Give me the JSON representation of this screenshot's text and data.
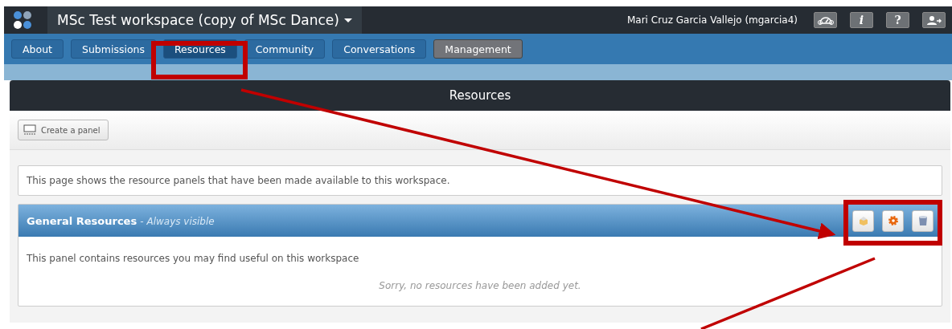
{
  "workspace": {
    "title": "MSc Test workspace (copy of MSc Dance)",
    "user": "Mari Cruz Garcia Vallejo (mgarcia4)",
    "tools": [
      {
        "kind": "gauge"
      },
      {
        "kind": "info",
        "label": "i"
      },
      {
        "kind": "help",
        "label": "?"
      },
      {
        "kind": "exit"
      }
    ]
  },
  "tabs": [
    {
      "label": "About",
      "selected": false,
      "kind": "normal"
    },
    {
      "label": "Submissions",
      "selected": false,
      "kind": "normal"
    },
    {
      "label": "Resources",
      "selected": true,
      "kind": "normal"
    },
    {
      "label": "Community",
      "selected": false,
      "kind": "normal"
    },
    {
      "label": "Conversations",
      "selected": false,
      "kind": "normal"
    },
    {
      "label": "Management",
      "selected": false,
      "kind": "admin"
    }
  ],
  "page": {
    "title": "Resources",
    "create_button": "Create a panel",
    "intro": "This page shows the resource panels that have been made available to this workspace."
  },
  "panels": [
    {
      "title": "General Resources",
      "subtitle": "- Always visible",
      "description": "This panel contains resources you may find useful on this workspace",
      "empty_note": "Sorry, no resources have been added yet.",
      "actions": [
        {
          "kind": "box"
        },
        {
          "kind": "gear"
        },
        {
          "kind": "trash"
        }
      ]
    }
  ]
}
